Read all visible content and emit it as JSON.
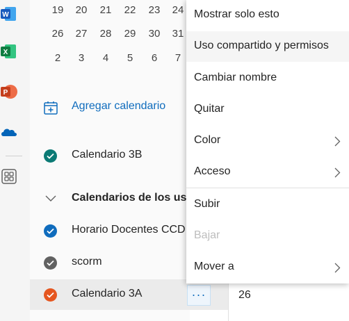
{
  "rail": {
    "apps": [
      "word-icon",
      "excel-icon",
      "powerpoint-icon",
      "onedrive-icon",
      "apps-grid-icon"
    ]
  },
  "mini_calendar": {
    "weeks": [
      [
        "19",
        "20",
        "21",
        "22",
        "23",
        "24"
      ],
      [
        "26",
        "27",
        "28",
        "29",
        "30",
        "31"
      ],
      [
        "2",
        "3",
        "4",
        "5",
        "6",
        "7"
      ]
    ]
  },
  "sidebar": {
    "add_calendar": "Agregar calendario",
    "calendar_3b": "Calendario 3B",
    "group_label": "Calendarios de los us",
    "horario": "Horario Docentes CCD",
    "scorm": "scorm",
    "calendario_3a": "Calendario 3A",
    "more_label": "···"
  },
  "grid": {
    "date": "26"
  },
  "context_menu": {
    "items": [
      {
        "label": "Mostrar solo esto"
      },
      {
        "label": "Uso compartido y permisos"
      },
      {
        "label": "Cambiar nombre"
      },
      {
        "label": "Quitar"
      },
      {
        "label": "Color"
      },
      {
        "label": "Acceso"
      },
      {
        "label": "Subir"
      },
      {
        "label": "Bajar"
      },
      {
        "label": "Mover a"
      }
    ]
  },
  "colors": {
    "teal": "#0b7a75",
    "blue": "#0f6cbd",
    "gray": "#616161",
    "orange": "#e5561f",
    "word": "#185abd",
    "excel": "#107c41",
    "powerpoint": "#c43e1c",
    "onedrive": "#0364b8"
  }
}
